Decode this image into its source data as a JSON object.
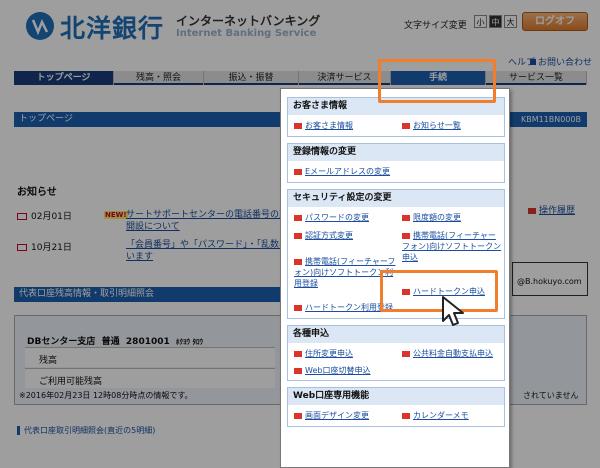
{
  "header": {
    "bank_name": "北洋銀行",
    "service_ja": "インターネットバンキング",
    "service_en": "Internet Banking Service",
    "font_size_label": "文字サイズ変更",
    "font_sizes": [
      "小",
      "中",
      "大"
    ],
    "logout": "ログオフ",
    "links": [
      "ヘルプ",
      "お問い合わせ"
    ]
  },
  "nav": {
    "tabs": [
      "トップページ",
      "残高・照会",
      "振込・振替",
      "決済サービス",
      "手続",
      "サービス一覧"
    ],
    "active_index": 0
  },
  "page": {
    "section_title": "トップページ",
    "screen_id": "KBM11BN000B",
    "notices_title": "お知らせ",
    "news": [
      {
        "date": "02月01日",
        "badge": "NEW!",
        "text1": "サートサポートセンターの電話番号の変",
        "text2": "開設について"
      },
      {
        "date": "10月21日",
        "text1": "「会員番号」や「パスワード」・「乱数表」",
        "text2": "います"
      }
    ],
    "history_link": "操作履歴",
    "email_fragment": "@B.hokuyo.com",
    "account_section": "代表口座残高情報・取引明細照会",
    "branch": "DBセンター支店",
    "account_type": "普通",
    "account_no": "2801001",
    "holder": "ﾎｸﾖｳ ﾀﾛｳ",
    "balance_label": "残高",
    "available_label": "ご利用可能残高",
    "as_of": "※2016年02月23日 12時08分時点の情報です。",
    "right_fragment": "されていません",
    "bottom_section": "代表口座取引明細照会(直近の5明細)"
  },
  "menu": {
    "groups": [
      {
        "title": "お客さま情報",
        "items": [
          "お客さま情報",
          "お知らせ一覧"
        ]
      },
      {
        "title": "登録情報の変更",
        "items": [
          "Eメールアドレスの変更"
        ]
      },
      {
        "title": "セキュリティ設定の変更",
        "items": [
          "パスワードの変更",
          "限度額の変更",
          "認証方式変更",
          "携帯電話(フィーチャーフォン)向けソフトトークン申込",
          "携帯電話(フィーチャーフォン)向けソフトトークン利用登録",
          "ハードトークン申込",
          "ハードトークン利用登録"
        ]
      },
      {
        "title": "各種申込",
        "items": [
          "住所変更申込",
          "公共料金自動支払申込",
          "Web口座切替申込"
        ]
      },
      {
        "title": "Web口座専用機能",
        "items": [
          "画面デザイン変更",
          "カレンダーメモ"
        ]
      }
    ]
  },
  "colors": {
    "brand": "#1f6fb8",
    "nav": "#1b3d7a",
    "highlight": "#f07e2a",
    "menu_icon": "#d9352a"
  }
}
